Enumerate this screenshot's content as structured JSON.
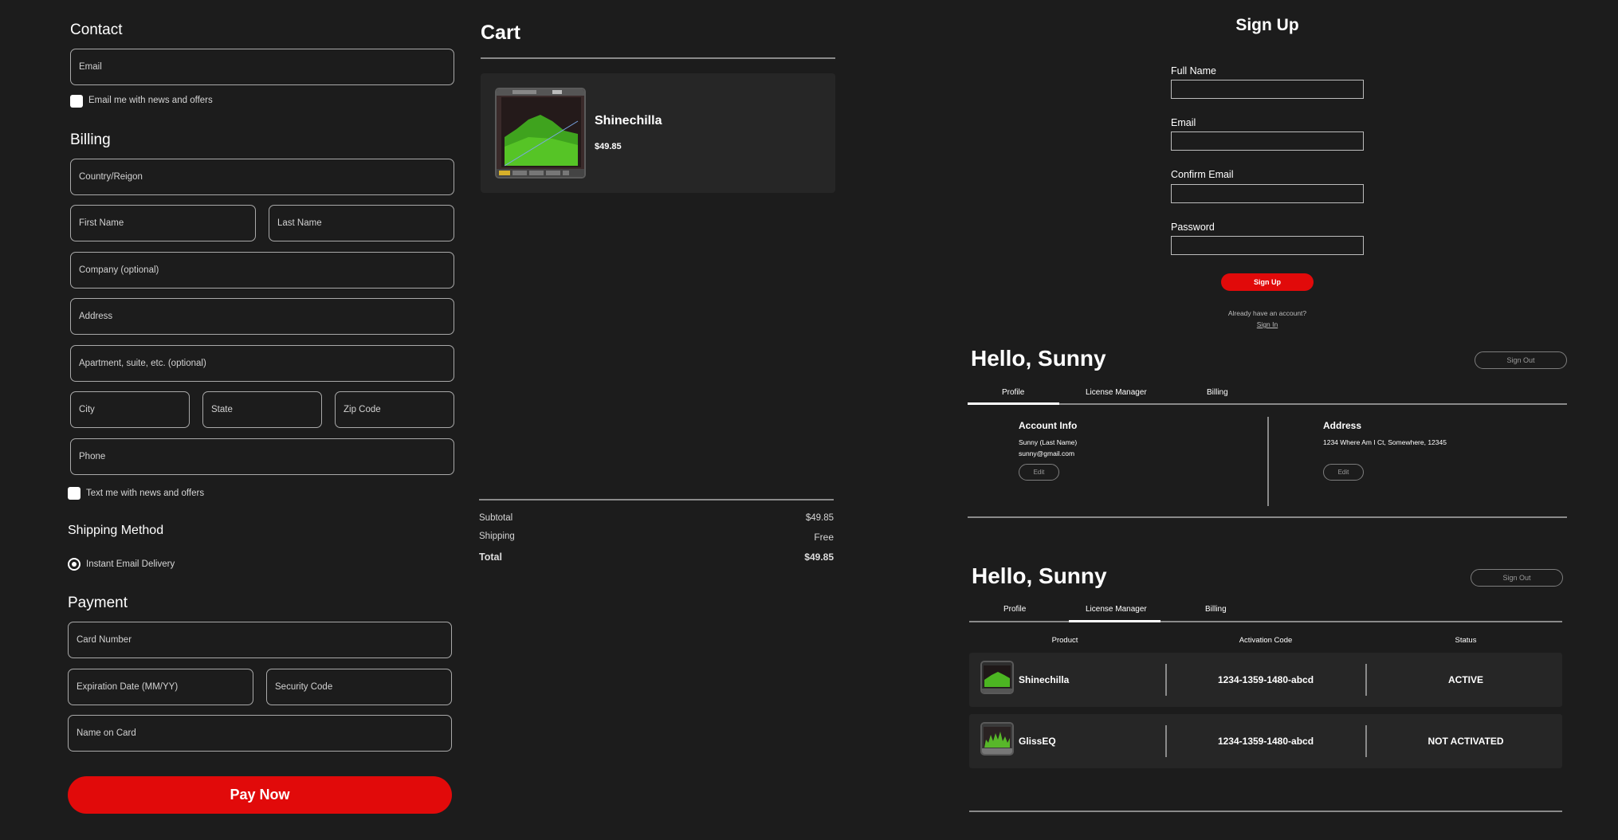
{
  "checkout": {
    "contact_title": "Contact",
    "email_placeholder": "Email",
    "email_news_label": "Email me with news and offers",
    "billing_title": "Billing",
    "country_placeholder": "Country/Reigon",
    "first_name_placeholder": "First Name",
    "last_name_placeholder": "Last Name",
    "company_placeholder": "Company (optional)",
    "address_placeholder": "Address",
    "apartment_placeholder": "Apartment, suite, etc. (optional)",
    "city_placeholder": "City",
    "state_placeholder": "State",
    "zip_placeholder": "Zip Code",
    "phone_placeholder": "Phone",
    "text_news_label": "Text me with news and offers",
    "shipping_title": "Shipping Method",
    "shipping_option": "Instant Email Delivery",
    "payment_title": "Payment",
    "card_number_placeholder": "Card Number",
    "expiration_placeholder": "Expiration Date (MM/YY)",
    "security_code_placeholder": "Security Code",
    "name_on_card_placeholder": "Name on Card",
    "pay_now_label": "Pay Now"
  },
  "cart": {
    "title": "Cart",
    "item": {
      "name": "Shinechilla",
      "price": "$49.85"
    },
    "subtotal_label": "Subtotal",
    "subtotal_value": "$49.85",
    "shipping_label": "Shipping",
    "shipping_value": "Free",
    "total_label": "Total",
    "total_value": "$49.85"
  },
  "signup": {
    "title": "Sign Up",
    "full_name_label": "Full Name",
    "email_label": "Email",
    "confirm_email_label": "Confirm Email",
    "password_label": "Password",
    "button_label": "Sign Up",
    "already_text": "Already have an account?",
    "sign_in_link": "Sign In"
  },
  "profile": {
    "greeting": "Hello, Sunny",
    "sign_out_label": "Sign Out",
    "tabs": [
      "Profile",
      "License Manager",
      "Billing"
    ],
    "account_info_title": "Account Info",
    "account_name": "Sunny (Last Name)",
    "account_email": "sunny@gmail.com",
    "edit_label": "Edit",
    "address_title": "Address",
    "address_value": "1234 Where Am I Ct, Somewhere, 12345"
  },
  "license": {
    "greeting": "Hello, Sunny",
    "sign_out_label": "Sign Out",
    "tabs": [
      "Profile",
      "License Manager",
      "Billing"
    ],
    "columns": [
      "Product",
      "Activation Code",
      "Status"
    ],
    "rows": [
      {
        "product": "Shinechilla",
        "code": "1234-1359-1480-abcd",
        "status": "ACTIVE"
      },
      {
        "product": "GlissEQ",
        "code": "1234-1359-1480-abcd",
        "status": "NOT ACTIVATED"
      }
    ]
  },
  "colors": {
    "accent": "#e10a0a",
    "background": "#1c1c1c",
    "panel": "#262626"
  },
  "icons": [
    "checkbox",
    "radio-selected",
    "plugin-thumbnail"
  ]
}
